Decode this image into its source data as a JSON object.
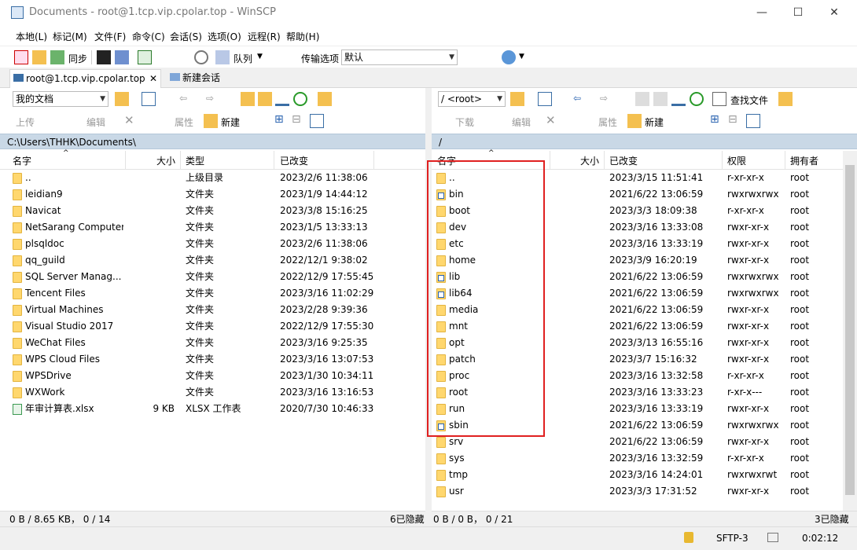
{
  "window": {
    "title": "Documents - root@1.tcp.vip.cpolar.top - WinSCP",
    "minimize": "—",
    "maximize": "☐",
    "close": "✕"
  },
  "menu": [
    "本地(L)",
    "标记(M)",
    "文件(F)",
    "命令(C)",
    "会话(S)",
    "选项(O)",
    "远程(R)",
    "帮助(H)"
  ],
  "toolbar": {
    "sync": "同步",
    "queue": "队列",
    "transfer_label": "传输选项",
    "transfer_value": "默认"
  },
  "tabs": {
    "session": "root@1.tcp.vip.cpolar.top",
    "new_session": "新建会话"
  },
  "left": {
    "location": "我的文档",
    "upload": "上传",
    "edit": "编辑",
    "properties": "属性",
    "new": "新建",
    "path": "C:\\Users\\THHK\\Documents\\",
    "headers": {
      "name": "名字",
      "size": "大小",
      "type": "类型",
      "changed": "已改变"
    },
    "rows": [
      {
        "name": "..",
        "size": "",
        "type": "上级目录",
        "changed": "2023/2/6  11:38:06",
        "kind": "up"
      },
      {
        "name": "leidian9",
        "size": "",
        "type": "文件夹",
        "changed": "2023/1/9  14:44:12",
        "kind": "folder"
      },
      {
        "name": "Navicat",
        "size": "",
        "type": "文件夹",
        "changed": "2023/3/8  15:16:25",
        "kind": "folder"
      },
      {
        "name": "NetSarang Computer",
        "size": "",
        "type": "文件夹",
        "changed": "2023/1/5  13:33:13",
        "kind": "folder"
      },
      {
        "name": "plsqldoc",
        "size": "",
        "type": "文件夹",
        "changed": "2023/2/6  11:38:06",
        "kind": "folder"
      },
      {
        "name": "qq_guild",
        "size": "",
        "type": "文件夹",
        "changed": "2022/12/1  9:38:02",
        "kind": "folder"
      },
      {
        "name": "SQL Server Manag...",
        "size": "",
        "type": "文件夹",
        "changed": "2022/12/9  17:55:45",
        "kind": "folder"
      },
      {
        "name": "Tencent Files",
        "size": "",
        "type": "文件夹",
        "changed": "2023/3/16  11:02:29",
        "kind": "folder"
      },
      {
        "name": "Virtual Machines",
        "size": "",
        "type": "文件夹",
        "changed": "2023/2/28  9:39:36",
        "kind": "folder"
      },
      {
        "name": "Visual Studio 2017",
        "size": "",
        "type": "文件夹",
        "changed": "2022/12/9  17:55:30",
        "kind": "folder"
      },
      {
        "name": "WeChat Files",
        "size": "",
        "type": "文件夹",
        "changed": "2023/3/16  9:25:35",
        "kind": "folder"
      },
      {
        "name": "WPS Cloud Files",
        "size": "",
        "type": "文件夹",
        "changed": "2023/3/16  13:07:53",
        "kind": "folder"
      },
      {
        "name": "WPSDrive",
        "size": "",
        "type": "文件夹",
        "changed": "2023/1/30  10:34:11",
        "kind": "folder"
      },
      {
        "name": "WXWork",
        "size": "",
        "type": "文件夹",
        "changed": "2023/3/16  13:16:53",
        "kind": "folder"
      },
      {
        "name": "年审计算表.xlsx",
        "size": "9 KB",
        "type": "XLSX 工作表",
        "changed": "2020/7/30  10:46:33",
        "kind": "xlsx"
      }
    ],
    "status_left": "0 B / 8.65 KB，  0 / 14",
    "status_right": "6已隐藏"
  },
  "right": {
    "location": "/  <root>",
    "find": "查找文件",
    "download": "下载",
    "edit": "编辑",
    "properties": "属性",
    "new": "新建",
    "path": "/",
    "headers": {
      "name": "名字",
      "size": "大小",
      "changed": "已改变",
      "rights": "权限",
      "owner": "拥有者"
    },
    "rows": [
      {
        "name": "..",
        "changed": "2023/3/15 11:51:41",
        "rights": "r-xr-xr-x",
        "owner": "root",
        "kind": "up"
      },
      {
        "name": "bin",
        "changed": "2021/6/22 13:06:59",
        "rights": "rwxrwxrwx",
        "owner": "root",
        "kind": "link"
      },
      {
        "name": "boot",
        "changed": "2023/3/3 18:09:38",
        "rights": "r-xr-xr-x",
        "owner": "root",
        "kind": "folder"
      },
      {
        "name": "dev",
        "changed": "2023/3/16 13:33:08",
        "rights": "rwxr-xr-x",
        "owner": "root",
        "kind": "folder"
      },
      {
        "name": "etc",
        "changed": "2023/3/16 13:33:19",
        "rights": "rwxr-xr-x",
        "owner": "root",
        "kind": "folder"
      },
      {
        "name": "home",
        "changed": "2023/3/9 16:20:19",
        "rights": "rwxr-xr-x",
        "owner": "root",
        "kind": "folder"
      },
      {
        "name": "lib",
        "changed": "2021/6/22 13:06:59",
        "rights": "rwxrwxrwx",
        "owner": "root",
        "kind": "link"
      },
      {
        "name": "lib64",
        "changed": "2021/6/22 13:06:59",
        "rights": "rwxrwxrwx",
        "owner": "root",
        "kind": "link"
      },
      {
        "name": "media",
        "changed": "2021/6/22 13:06:59",
        "rights": "rwxr-xr-x",
        "owner": "root",
        "kind": "folder"
      },
      {
        "name": "mnt",
        "changed": "2021/6/22 13:06:59",
        "rights": "rwxr-xr-x",
        "owner": "root",
        "kind": "folder"
      },
      {
        "name": "opt",
        "changed": "2023/3/13 16:55:16",
        "rights": "rwxr-xr-x",
        "owner": "root",
        "kind": "folder"
      },
      {
        "name": "patch",
        "changed": "2023/3/7 15:16:32",
        "rights": "rwxr-xr-x",
        "owner": "root",
        "kind": "folder"
      },
      {
        "name": "proc",
        "changed": "2023/3/16 13:32:58",
        "rights": "r-xr-xr-x",
        "owner": "root",
        "kind": "folder"
      },
      {
        "name": "root",
        "changed": "2023/3/16 13:33:23",
        "rights": "r-xr-x---",
        "owner": "root",
        "kind": "folder"
      },
      {
        "name": "run",
        "changed": "2023/3/16 13:33:19",
        "rights": "rwxr-xr-x",
        "owner": "root",
        "kind": "folder"
      },
      {
        "name": "sbin",
        "changed": "2021/6/22 13:06:59",
        "rights": "rwxrwxrwx",
        "owner": "root",
        "kind": "link"
      },
      {
        "name": "srv",
        "changed": "2021/6/22 13:06:59",
        "rights": "rwxr-xr-x",
        "owner": "root",
        "kind": "folder"
      },
      {
        "name": "sys",
        "changed": "2023/3/16 13:32:59",
        "rights": "r-xr-xr-x",
        "owner": "root",
        "kind": "folder"
      },
      {
        "name": "tmp",
        "changed": "2023/3/16 14:24:01",
        "rights": "rwxrwxrwt",
        "owner": "root",
        "kind": "folder"
      },
      {
        "name": "usr",
        "changed": "2023/3/3 17:31:52",
        "rights": "rwxr-xr-x",
        "owner": "root",
        "kind": "folder"
      }
    ],
    "status_left": "0 B / 0 B，  0 / 21",
    "status_right": "3已隐藏"
  },
  "bottom": {
    "protocol": "SFTP-3",
    "time": "0:02:12"
  },
  "colors": {
    "path_bg": "#c9d8e6",
    "folder": "#ffd76e",
    "highlight": "#e02020"
  }
}
